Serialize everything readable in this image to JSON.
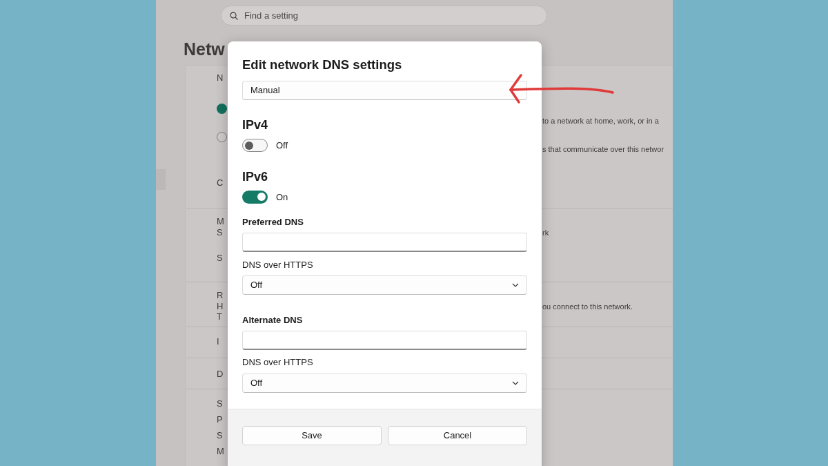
{
  "background_window": {
    "search": {
      "placeholder": "Find a setting"
    },
    "heading": "Netw",
    "lines": [
      {
        "kind": "text",
        "left": "N"
      },
      {
        "kind": "radio",
        "selected": true
      },
      {
        "kind": "text",
        "right": "to a network at home, work, or in a"
      },
      {
        "kind": "radio",
        "selected": false
      },
      {
        "kind": "text",
        "right": "s that communicate over this networ"
      },
      {
        "kind": "text",
        "left": "C"
      },
      {
        "kind": "text",
        "left": "M"
      },
      {
        "kind": "text",
        "left": "S",
        "right": "rk"
      },
      {
        "kind": "text",
        "left": "S"
      },
      {
        "kind": "text",
        "left": "R"
      },
      {
        "kind": "text",
        "left": "H",
        "right": "ou connect to this network."
      },
      {
        "kind": "text",
        "left": "T"
      },
      {
        "kind": "text",
        "left": "I"
      },
      {
        "kind": "text",
        "left": "D"
      },
      {
        "kind": "text",
        "left": "S"
      },
      {
        "kind": "text",
        "left": "P"
      },
      {
        "kind": "text",
        "left": "S"
      },
      {
        "kind": "text",
        "left": "M"
      }
    ]
  },
  "dialog": {
    "title": "Edit network DNS settings",
    "mode": "Manual",
    "protocols": [
      {
        "heading": "IPv4",
        "on": false,
        "state_label": "Off"
      },
      {
        "heading": "IPv6",
        "on": true,
        "state_label": "On"
      }
    ],
    "dns_servers": [
      {
        "label": "Preferred DNS",
        "https_label": "DNS over HTTPS",
        "https_value": "Off"
      },
      {
        "label": "Alternate DNS",
        "https_label": "DNS over HTTPS",
        "https_value": "Off"
      }
    ],
    "buttons": [
      "Save",
      "Cancel"
    ]
  }
}
